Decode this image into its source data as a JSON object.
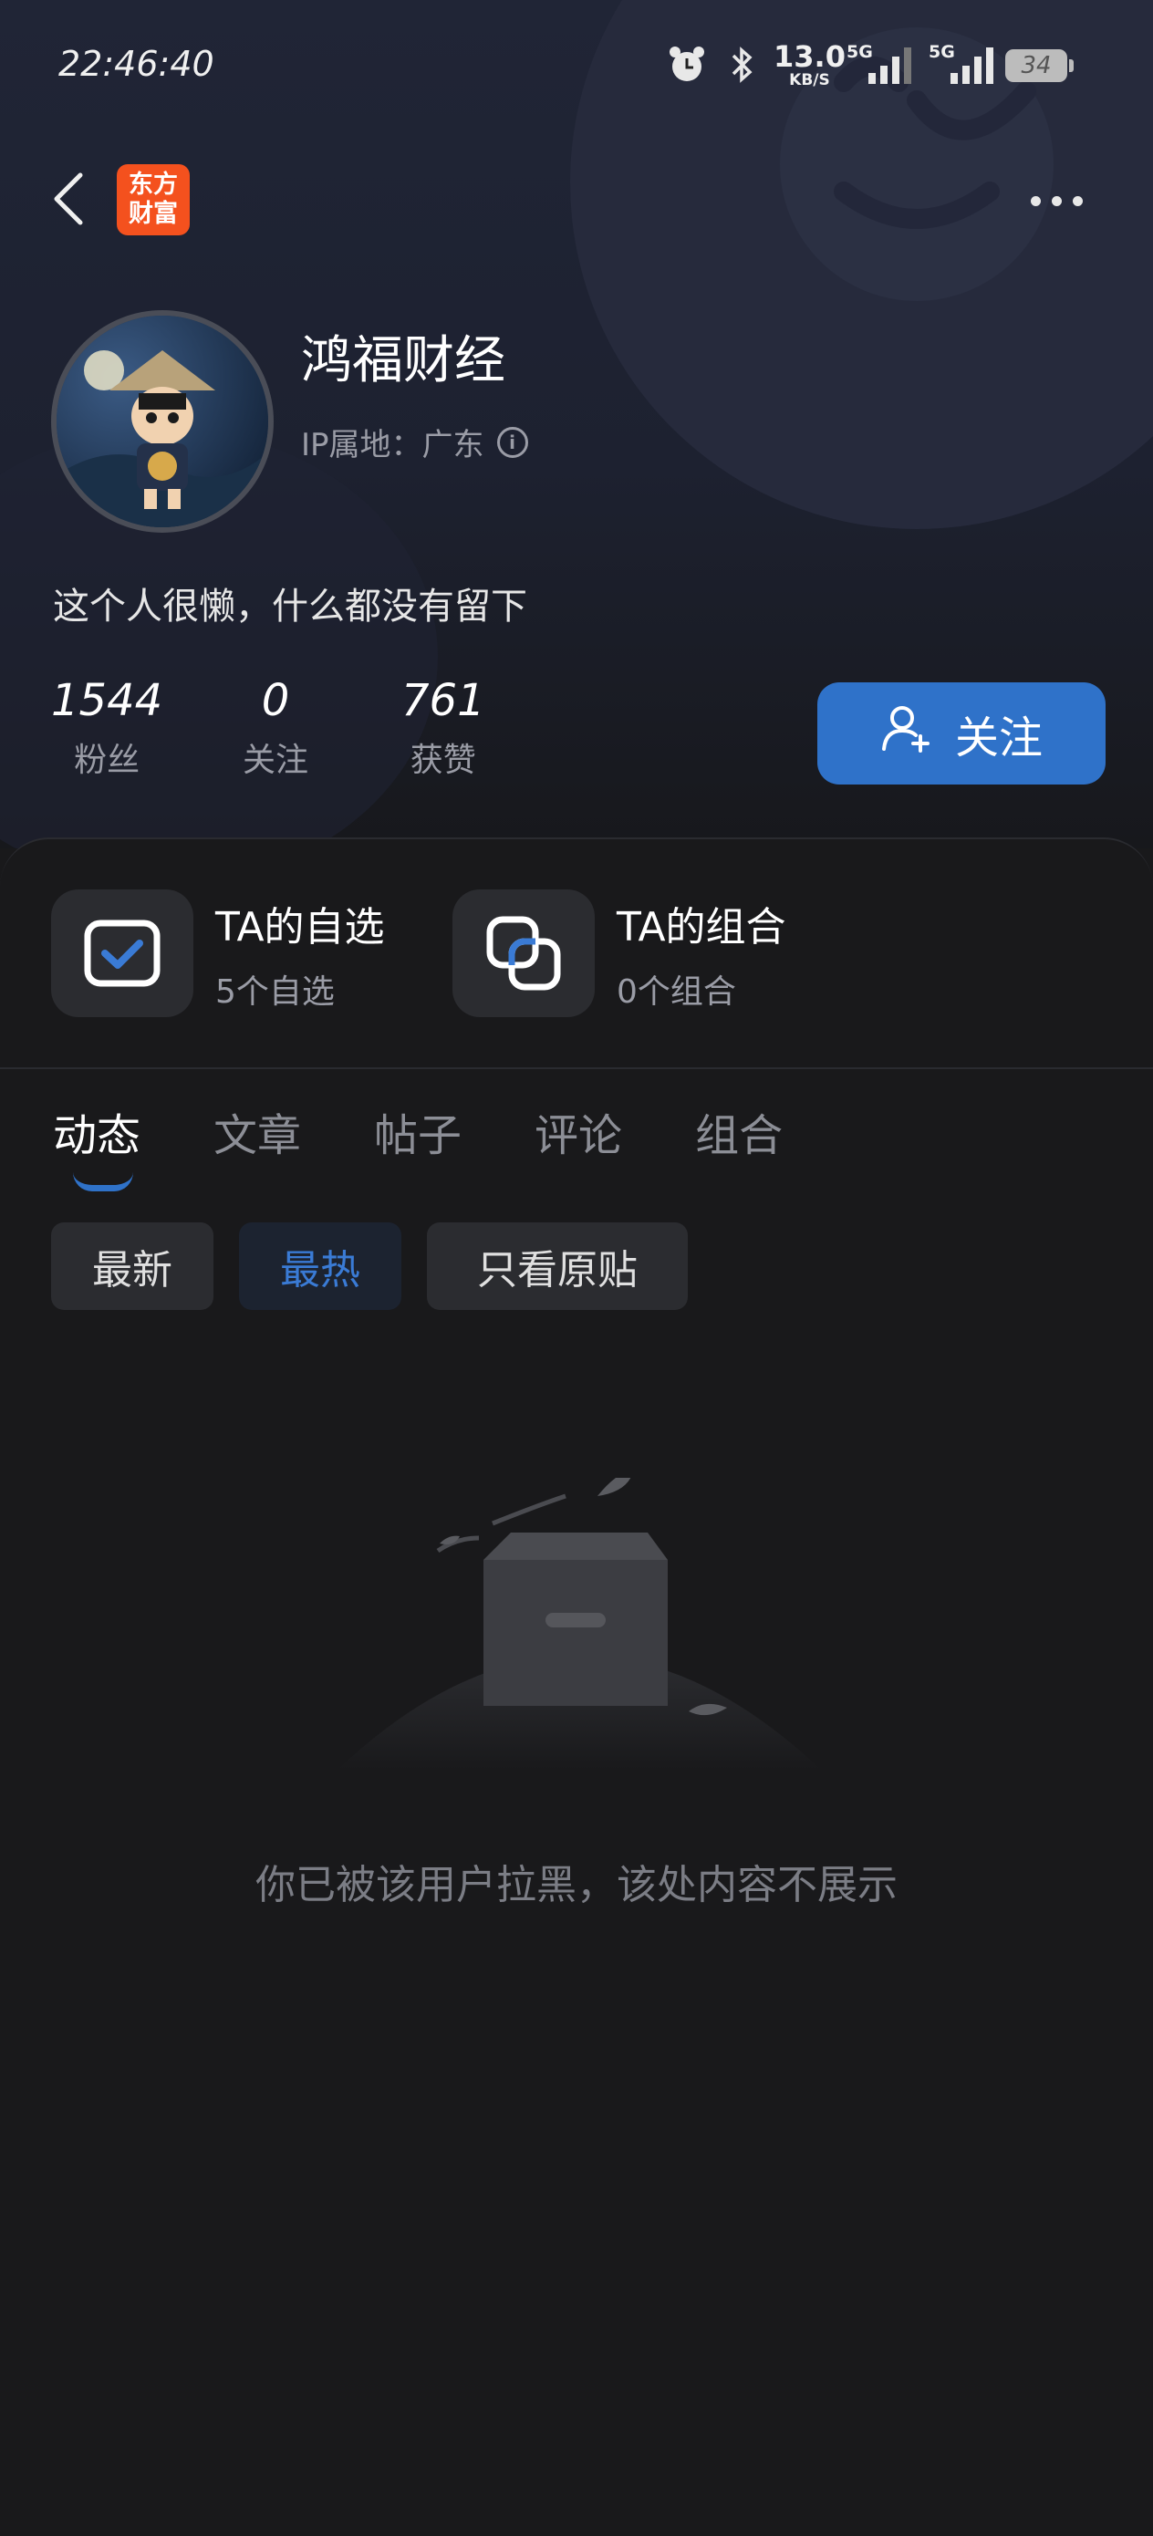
{
  "status_bar": {
    "time": "22:46:40",
    "net_speed_value": "13.0",
    "net_speed_unit": "KB/S",
    "signal_1_label": "5G",
    "signal_2_label": "5G",
    "battery": "34"
  },
  "nav": {
    "app_logo_text_line1": "东方",
    "app_logo_text_line2": "财富"
  },
  "profile": {
    "name": "鸿福财经",
    "ip_location": "IP属地：广东",
    "bio": "这个人很懒，什么都没有留下",
    "stats": [
      {
        "value": "1544",
        "label": "粉丝"
      },
      {
        "value": "0",
        "label": "关注"
      },
      {
        "value": "761",
        "label": "获赞"
      }
    ],
    "follow_label": "关注"
  },
  "cards": [
    {
      "title": "TA的自选",
      "subtitle": "5个自选"
    },
    {
      "title": "TA的组合",
      "subtitle": "0个组合"
    }
  ],
  "tabs": [
    "动态",
    "文章",
    "帖子",
    "评论",
    "组合"
  ],
  "filters": [
    "最新",
    "最热",
    "只看原贴"
  ],
  "empty_state": {
    "message": "你已被该用户拉黑，该处内容不展示"
  },
  "colors": {
    "accent": "#2f72c9",
    "background": "#19191b",
    "logo": "#f4511e"
  }
}
